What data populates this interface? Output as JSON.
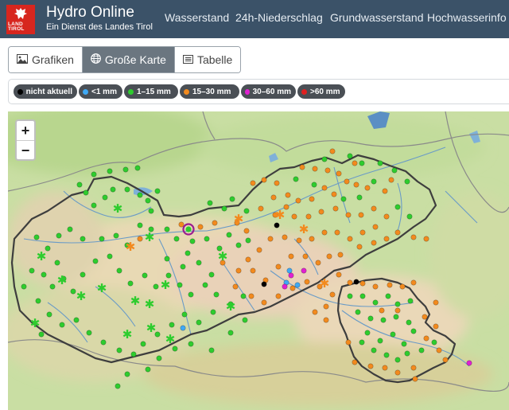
{
  "header": {
    "logo_text": "LAND TIROL",
    "title": "Hydro Online",
    "subtitle": "Ein Dienst des Landes Tirol",
    "nav": [
      "Wasserstand",
      "24h-Niederschlag",
      "Grundwasserstand",
      "Hochwasserinfo"
    ]
  },
  "view_tabs": [
    {
      "label": "Grafiken",
      "icon": "image-icon",
      "active": false
    },
    {
      "label": "Große Karte",
      "icon": "globe-icon",
      "active": true
    },
    {
      "label": "Tabelle",
      "icon": "table-icon",
      "active": false
    }
  ],
  "legend": [
    {
      "label": "nicht aktuell",
      "color": "#000000"
    },
    {
      "label": "<1 mm",
      "color": "#3fa9f5"
    },
    {
      "label": "1–15 mm",
      "color": "#2ecc2e"
    },
    {
      "label": "15–30 mm",
      "color": "#f28a1e"
    },
    {
      "label": "30–60 mm",
      "color": "#e020d0"
    },
    {
      "label": ">60 mm",
      "color": "#e02020"
    }
  ],
  "map": {
    "zoom_in": "+",
    "zoom_out": "−"
  }
}
